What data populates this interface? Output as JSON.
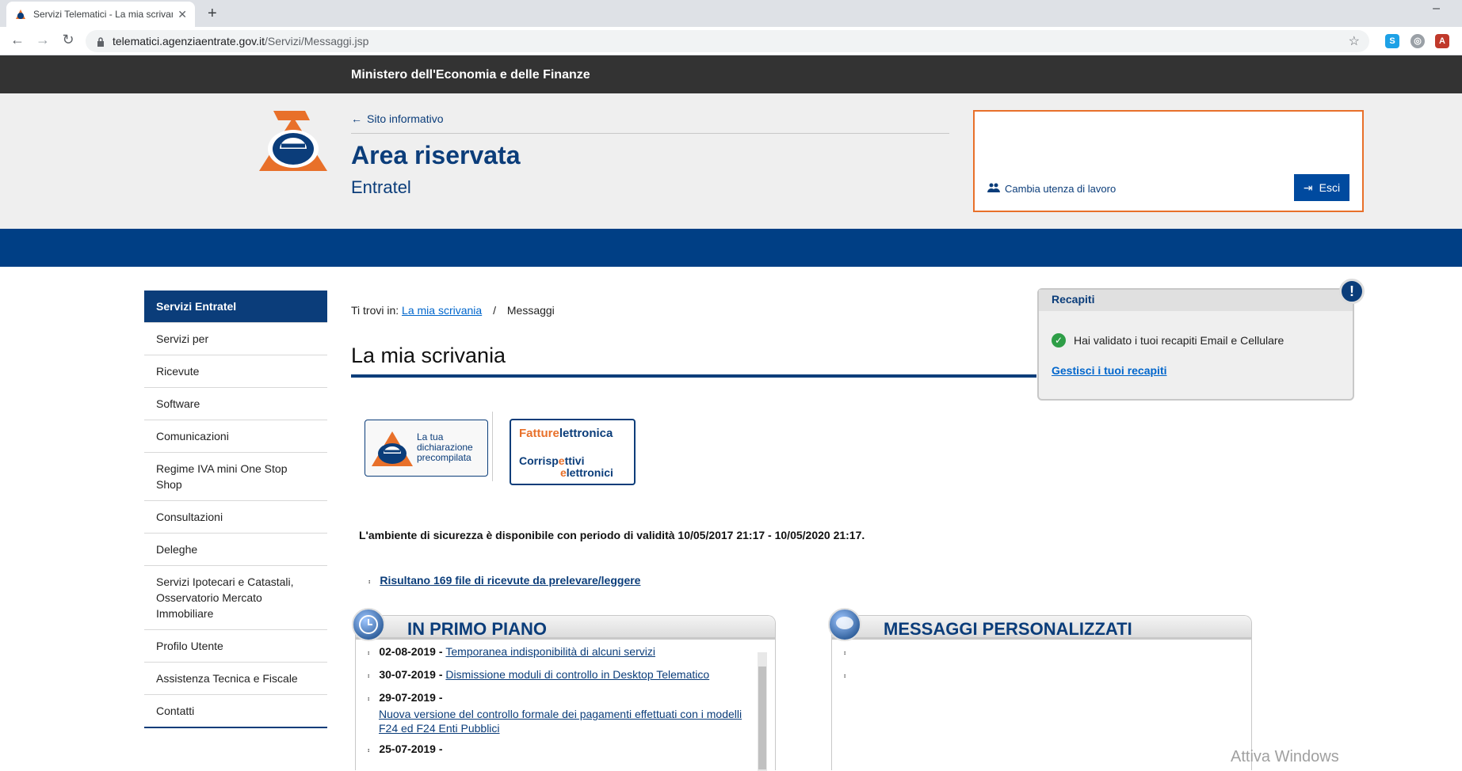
{
  "browser": {
    "tab_title": "Servizi Telematici - La mia scrivani",
    "url_host": "telematici.agenziaentrate.gov.it",
    "url_path": "/Servizi/Messaggi.jsp"
  },
  "header": {
    "ministry": "Ministero dell'Economia e delle Finanze",
    "site_link": "Sito informativo",
    "title": "Area riservata",
    "subtitle": "Entratel",
    "cambia_utenza": "Cambia utenza di lavoro",
    "esci": "Esci"
  },
  "sidebar": {
    "title": "Servizi Entratel",
    "items": [
      "Servizi per",
      "Ricevute",
      "Software",
      "Comunicazioni",
      "Regime IVA mini One Stop Shop",
      "Consultazioni",
      "Deleghe",
      "Servizi Ipotecari e Catastali, Osservatorio Mercato Immobiliare",
      "Profilo Utente",
      "Assistenza Tecnica e Fiscale",
      "Contatti"
    ]
  },
  "breadcrumb": {
    "prefix": "Ti trovi in:",
    "link": "La mia scrivania",
    "current": "Messaggi"
  },
  "main": {
    "title": "La mia scrivania",
    "banner1": [
      "La tua",
      "dichiarazione",
      "precompilata"
    ],
    "banner2_line1_a": "Fattur",
    "banner2_line1_b": "lettronica",
    "banner2_line2": [
      "Corrisp",
      "ttivi",
      "lettronici"
    ],
    "security_text": "L'ambiente di sicurezza è disponibile con periodo di validità 10/05/2017 21:17 - 10/05/2020 21:17.",
    "ricevute_link": "Risultano 169 file di ricevute da prelevare/leggere"
  },
  "primo_piano": {
    "title": "IN PRIMO PIANO",
    "items": [
      {
        "date": "02-08-2019 -",
        "text": "Temporanea indisponibilità di alcuni servizi"
      },
      {
        "date": "30-07-2019 -",
        "text": "Dismissione moduli di controllo in Desktop Telematico"
      },
      {
        "date": "29-07-2019 -",
        "text": "Nuova versione del controllo formale dei pagamenti effettuati con i modelli F24 ed F24 Enti Pubblici"
      },
      {
        "date": "25-07-2019 -",
        "text": ""
      }
    ]
  },
  "messaggi": {
    "title": "MESSAGGI PERSONALIZZATI"
  },
  "recapiti": {
    "title": "Recapiti",
    "status": "Hai validato i tuoi recapiti Email e Cellulare",
    "manage": "Gestisci i tuoi recapiti"
  },
  "watermark": "Attiva Windows"
}
